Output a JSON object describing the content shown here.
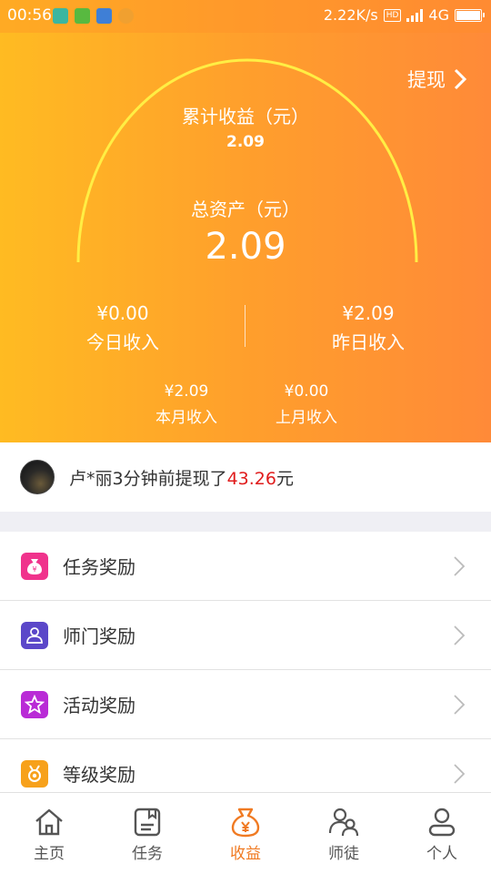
{
  "status_bar": {
    "time": "00:56",
    "speed": "2.22K/s",
    "hd": "HD",
    "network": "4G",
    "notif_icons": [
      "scan-icon",
      "refresh-icon",
      "message-icon",
      "app-icon"
    ]
  },
  "header": {
    "withdraw_label": "提现",
    "cumulative_label": "累计收益（元）",
    "cumulative_value": "2.09",
    "total_label": "总资产（元）",
    "total_value": "2.09",
    "today_amount": "¥0.00",
    "today_label": "今日收入",
    "yesterday_amount": "¥2.09",
    "yesterday_label": "昨日收入",
    "month_amount": "¥2.09",
    "month_label": "本月收入",
    "last_month_amount": "¥0.00",
    "last_month_label": "上月收入"
  },
  "ticker": {
    "text": "卢*丽3分钟前提现了",
    "amount": "43.26",
    "unit": "元"
  },
  "menu": [
    {
      "label": "任务奖励",
      "icon": "money-bag-icon",
      "color": "#f0338c"
    },
    {
      "label": "师门奖励",
      "icon": "people-icon",
      "color": "#5b47c9"
    },
    {
      "label": "活动奖励",
      "icon": "star-icon",
      "color": "#b92bd6"
    },
    {
      "label": "等级奖励",
      "icon": "medal-icon",
      "color": "#f7a11b"
    }
  ],
  "tabs": [
    {
      "label": "主页",
      "icon": "home-icon",
      "active": false
    },
    {
      "label": "任务",
      "icon": "task-icon",
      "active": false
    },
    {
      "label": "收益",
      "icon": "money-bag-icon",
      "active": true
    },
    {
      "label": "师徒",
      "icon": "mentor-icon",
      "active": false
    },
    {
      "label": "个人",
      "icon": "person-icon",
      "active": false
    }
  ],
  "colors": {
    "accent": "#f07a22",
    "highlight_amount": "#e01c1c",
    "header_gradient_start": "#ffbb22",
    "header_gradient_end": "#ff8a38",
    "arc": "#ffee44"
  }
}
